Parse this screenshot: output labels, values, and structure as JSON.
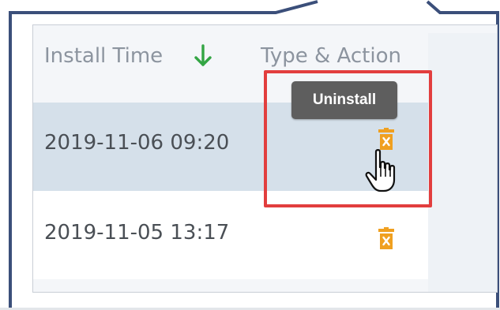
{
  "table": {
    "columns": [
      {
        "label": "Install Time",
        "sort": "descending"
      },
      {
        "label": "Type & Action"
      }
    ],
    "rows": [
      {
        "install_time": "2019-11-06 09:20",
        "action_icon": "trash-icon",
        "selected": true
      },
      {
        "install_time": "2019-11-05 13:17",
        "action_icon": "trash-icon",
        "selected": false
      }
    ]
  },
  "tooltip": {
    "text": "Uninstall"
  },
  "icons": {
    "sort": "arrow-down-icon",
    "action": "trash-icon",
    "cursor": "hand-pointer-icon"
  },
  "colors": {
    "frame": "#3b4f7a",
    "sort_arrow": "#33a544",
    "trash": "#f0a020",
    "highlight": "#e23e3e",
    "selected_row": "#d5e0ea",
    "tooltip_bg": "#5e5e5e"
  }
}
